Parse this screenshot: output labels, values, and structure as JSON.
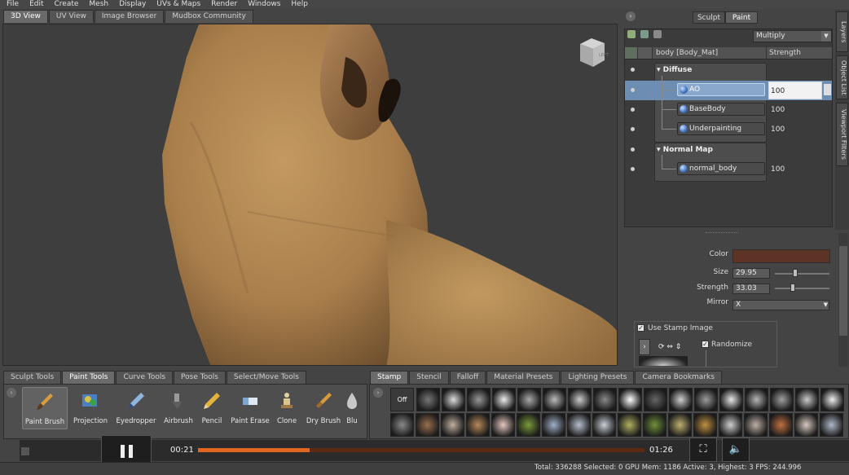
{
  "menu": [
    "File",
    "Edit",
    "Create",
    "Mesh",
    "Display",
    "UVs & Maps",
    "Render",
    "Windows",
    "Help"
  ],
  "viewport_tabs": [
    {
      "label": "3D View",
      "active": true
    },
    {
      "label": "UV View",
      "active": false
    },
    {
      "label": "Image Browser",
      "active": false
    },
    {
      "label": "Mudbox Community",
      "active": false
    }
  ],
  "view_cube_label": "LEFT",
  "mode_switch": {
    "sculpt": "Sculpt",
    "paint": "Paint",
    "active": "paint"
  },
  "side_tabs": [
    "Layers",
    "Object List",
    "Viewport Filters"
  ],
  "layers": {
    "blend_mode": "Multiply",
    "header_name": "body [Body_Mat]",
    "header_strength": "Strength",
    "groups": [
      {
        "name": "Diffuse",
        "layers": [
          {
            "name": "AO",
            "strength": "100",
            "selected": true
          },
          {
            "name": "BaseBody",
            "strength": "100",
            "selected": false
          },
          {
            "name": "Underpainting",
            "strength": "100",
            "selected": false
          }
        ]
      },
      {
        "name": "Normal Map",
        "layers": [
          {
            "name": "normal_body",
            "strength": "100",
            "selected": false
          }
        ]
      }
    ]
  },
  "properties": {
    "color_label": "Color",
    "color_value": "#5c3325",
    "size_label": "Size",
    "size_value": "29.95",
    "size_fraction": 0.38,
    "strength_label": "Strength",
    "strength_value": "33.03",
    "strength_fraction": 0.33,
    "mirror_label": "Mirror",
    "mirror_value": "X",
    "use_stamp_label": "Use Stamp Image",
    "randomize_label": "Randomize"
  },
  "tool_tabs": [
    {
      "label": "Sculpt Tools",
      "active": false
    },
    {
      "label": "Paint Tools",
      "active": true
    },
    {
      "label": "Curve Tools",
      "active": false
    },
    {
      "label": "Pose Tools",
      "active": false
    },
    {
      "label": "Select/Move Tools",
      "active": false
    }
  ],
  "tools": [
    {
      "label": "Paint Brush",
      "icon": "paint-brush-icon",
      "selected": true
    },
    {
      "label": "Projection",
      "icon": "projection-icon",
      "selected": false
    },
    {
      "label": "Eyedropper",
      "icon": "eyedropper-icon",
      "selected": false
    },
    {
      "label": "Airbrush",
      "icon": "airbrush-icon",
      "selected": false
    },
    {
      "label": "Pencil",
      "icon": "pencil-icon",
      "selected": false
    },
    {
      "label": "Paint Erase",
      "icon": "paint-erase-icon",
      "selected": false
    },
    {
      "label": "Clone",
      "icon": "clone-icon",
      "selected": false
    },
    {
      "label": "Dry Brush",
      "icon": "dry-brush-icon",
      "selected": false
    },
    {
      "label": "Blu",
      "icon": "blur-icon",
      "selected": false
    }
  ],
  "stamp_tabs": [
    {
      "label": "Stamp",
      "active": true
    },
    {
      "label": "Stencil",
      "active": false
    },
    {
      "label": "Falloff",
      "active": false
    },
    {
      "label": "Material Presets",
      "active": false
    },
    {
      "label": "Lighting Presets",
      "active": false
    },
    {
      "label": "Camera Bookmarks",
      "active": false
    }
  ],
  "stamp_off_label": "Off",
  "player": {
    "current_time": "00:21",
    "total_time": "01:26",
    "progress": 0.25
  },
  "status": "Total: 336288  Selected: 0 GPU Mem: 1186  Active: 3, Highest: 3  FPS: 244.996"
}
